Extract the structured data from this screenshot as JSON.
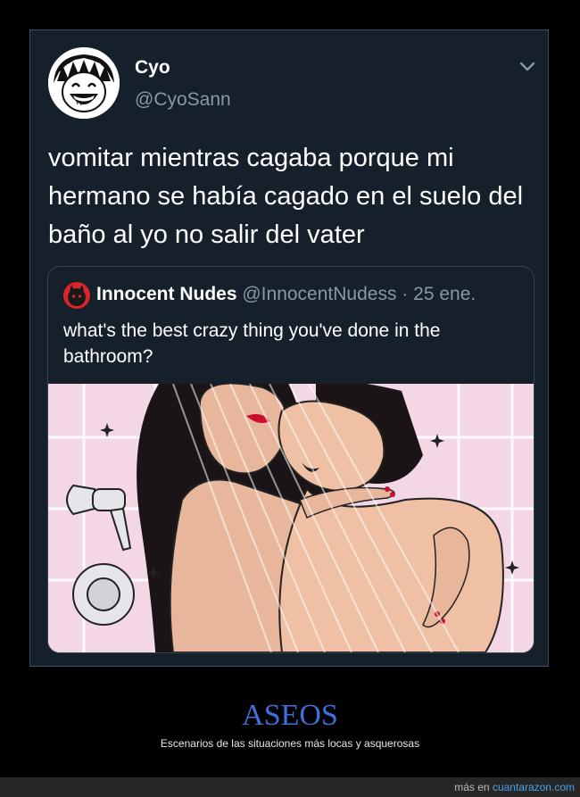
{
  "tweet": {
    "author_name": "Cyo",
    "author_handle": "@CyoSann",
    "text": "vomitar mientras cagaba porque mi hermano se había cagado en el suelo del baño al yo no salir del vater",
    "menu_icon": "chevron-down-icon",
    "quoted": {
      "author_name": "Innocent Nudes",
      "author_handle": "@InnocentNudess",
      "separator": "·",
      "date": "25 ene.",
      "text": "what's the best crazy thing you've done in the bathroom?"
    }
  },
  "caption": {
    "title": "ASEOS",
    "subtitle": "Escenarios de las situaciones más locas y asquerosas"
  },
  "footer": {
    "prefix": "más en",
    "site": "cuantarazon.com"
  },
  "colors": {
    "page_bg": "#000000",
    "tweet_bg": "#15202b",
    "secondary_text": "#8899a6",
    "title_blue": "#3f6fd8",
    "link_blue": "#4aa3e8"
  }
}
